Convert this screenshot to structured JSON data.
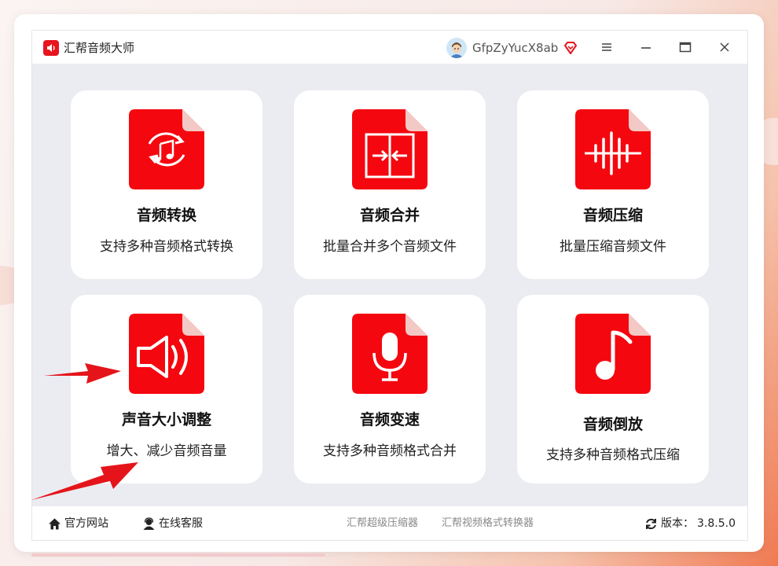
{
  "app": {
    "title": "汇帮音频大师",
    "username": "GfpZyYucX8ab",
    "accent_color": "#e8141e",
    "icons": {
      "logo": "speaker-icon",
      "vip": "diamond-icon",
      "menu": "menu-icon",
      "minimize": "minimize-icon",
      "maximize": "maximize-icon",
      "close": "close-icon"
    }
  },
  "tiles": [
    {
      "title": "音频转换",
      "desc": "支持多种音频格式转换",
      "icon": "audio-convert-icon"
    },
    {
      "title": "音频合并",
      "desc": "批量合并多个音频文件",
      "icon": "audio-merge-icon"
    },
    {
      "title": "音频压缩",
      "desc": "批量压缩音频文件",
      "icon": "audio-compress-icon"
    },
    {
      "title": "声音大小调整",
      "desc": "增大、减少音频音量",
      "icon": "volume-icon"
    },
    {
      "title": "音频变速",
      "desc": "支持多种音频格式合并",
      "icon": "microphone-icon"
    },
    {
      "title": "音频倒放",
      "desc": "支持多种音频格式压缩",
      "icon": "music-note-icon"
    }
  ],
  "footer": {
    "official_site": "官方网站",
    "online_service": "在线客服",
    "link_compressor": "汇帮超级压缩器",
    "link_video_converter": "汇帮视频格式转换器",
    "version_label": "版本：",
    "version": "3.8.5.0"
  },
  "annotation_arrow_color": "#e5141b"
}
